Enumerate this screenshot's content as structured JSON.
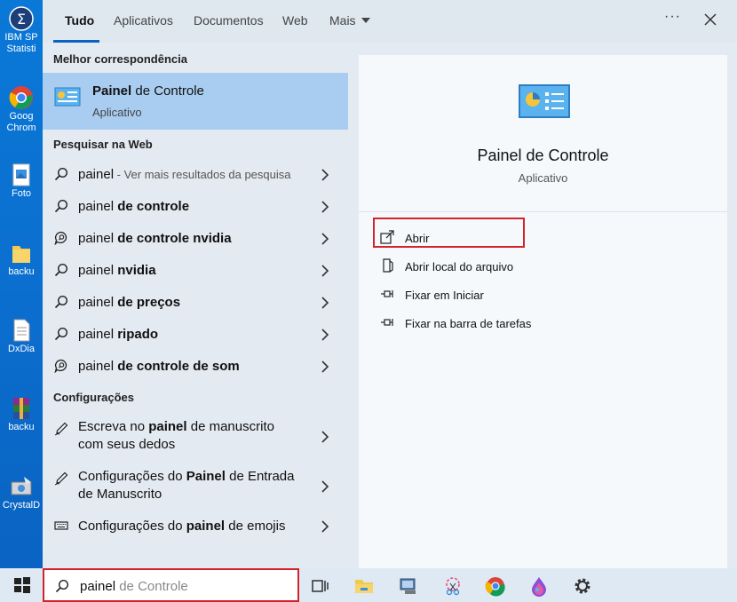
{
  "desktop_icons": [
    {
      "label": "IBM SP\nStatisti",
      "icon": "spss-icon"
    },
    {
      "label": "Goog\nChrom",
      "icon": "chrome-icon"
    },
    {
      "label": "Foto",
      "icon": "photos-icon"
    },
    {
      "label": "backu",
      "icon": "folder-icon"
    },
    {
      "label": "DxDia",
      "icon": "document-icon"
    },
    {
      "label": "backu",
      "icon": "winrar-icon"
    },
    {
      "label": "CrystalD",
      "icon": "crystaldisk-icon"
    }
  ],
  "tabs": [
    {
      "label": "Tudo",
      "active": true
    },
    {
      "label": "Aplicativos"
    },
    {
      "label": "Documentos"
    },
    {
      "label": "Web"
    },
    {
      "label": "Mais"
    }
  ],
  "header": {
    "more_icon": "ellipsis-icon",
    "more_text": "···",
    "close_icon": "close-icon"
  },
  "best_match": {
    "section_title": "Melhor correspondência",
    "title_bold": "Painel",
    "title_rest": " de Controle",
    "subtitle": "Aplicativo",
    "icon": "control-panel-icon"
  },
  "web": {
    "section_title": "Pesquisar na Web",
    "items": [
      {
        "prefix": "painel",
        "bold": "",
        "hint": " - Ver mais resultados da pesquisa",
        "icon": "search-icon"
      },
      {
        "prefix": "painel ",
        "bold": "de controle",
        "hint": "",
        "icon": "search-icon"
      },
      {
        "prefix": "painel ",
        "bold": "de controle nvidia",
        "hint": "",
        "icon": "chat-search-icon"
      },
      {
        "prefix": "painel ",
        "bold": "nvidia",
        "hint": "",
        "icon": "search-icon"
      },
      {
        "prefix": "painel ",
        "bold": "de preços",
        "hint": "",
        "icon": "search-icon"
      },
      {
        "prefix": "painel ",
        "bold": "ripado",
        "hint": "",
        "icon": "search-icon"
      },
      {
        "prefix": "painel ",
        "bold": "de controle de som",
        "hint": "",
        "icon": "chat-search-icon"
      }
    ]
  },
  "settings": {
    "section_title": "Configurações",
    "items": [
      {
        "l1_pre": "Escreva no ",
        "l1_bold": "painel",
        "l1_post": " de manuscrito",
        "l2_pre": "com seus dedos",
        "l2_bold": "",
        "l2_post": "",
        "icon": "pen-icon"
      },
      {
        "l1_pre": "Configurações do ",
        "l1_bold": "Painel",
        "l1_post": " de Entrada",
        "l2_pre": "de Manuscrito",
        "l2_bold": "",
        "l2_post": "",
        "icon": "pen-icon"
      },
      {
        "l1_pre": "Configurações do ",
        "l1_bold": "painel",
        "l1_post": " de emojis",
        "icon": "keyboard-icon"
      }
    ]
  },
  "preview": {
    "title": "Painel de Controle",
    "subtitle": "Aplicativo",
    "actions": [
      {
        "label": "Abrir",
        "icon": "open-icon"
      },
      {
        "label": "Abrir local do arquivo",
        "icon": "file-location-icon"
      },
      {
        "label": "Fixar em Iniciar",
        "icon": "pin-icon"
      },
      {
        "label": "Fixar na barra de tarefas",
        "icon": "pin-icon"
      }
    ]
  },
  "taskbar": {
    "search_typed": "painel",
    "search_ghost": " de Controle",
    "apps": [
      "task-view-icon",
      "file-explorer-icon",
      "network-app-icon",
      "snip-icon",
      "chrome-icon",
      "paint-drop-icon",
      "settings-gear-icon"
    ]
  },
  "colors": {
    "accent": "#0b62c2",
    "highlight": "#a9cdf0",
    "annotation_red": "#d2232a",
    "desktop_blue": "#0a78d7"
  }
}
